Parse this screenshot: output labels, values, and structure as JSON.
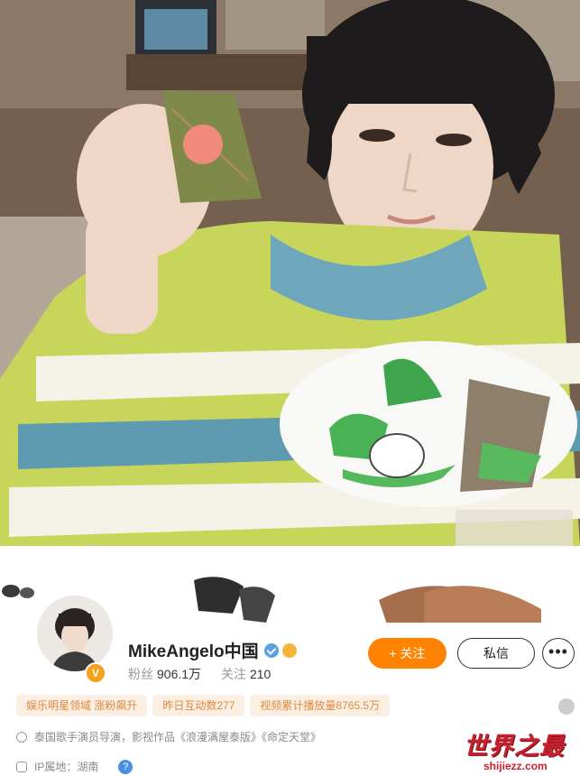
{
  "profile": {
    "name": "MikeAngelo中国",
    "fans_label": "粉丝",
    "fans_value": "906.1万",
    "following_label": "关注",
    "following_value": "210",
    "verified_badge": "V"
  },
  "actions": {
    "follow_label": "+ 关注",
    "message_label": "私信",
    "more_label": "•••"
  },
  "tags": [
    "娱乐明星领域 涨粉飙升",
    "昨日互动数277",
    "视频累计播放量8765.5万"
  ],
  "bio": "泰国歌手演员导演，影视作品《浪漫满屋泰版》《命定天堂》",
  "ip": {
    "label": "IP属地：湖南",
    "help": "?"
  },
  "watermark": {
    "title": "世界之最",
    "site": "shijiezz.com"
  },
  "colors": {
    "follow_button": "#ff8200",
    "tag_bg": "#fbeee2",
    "tag_text": "#e08a3c",
    "watermark": "#c9202f"
  }
}
